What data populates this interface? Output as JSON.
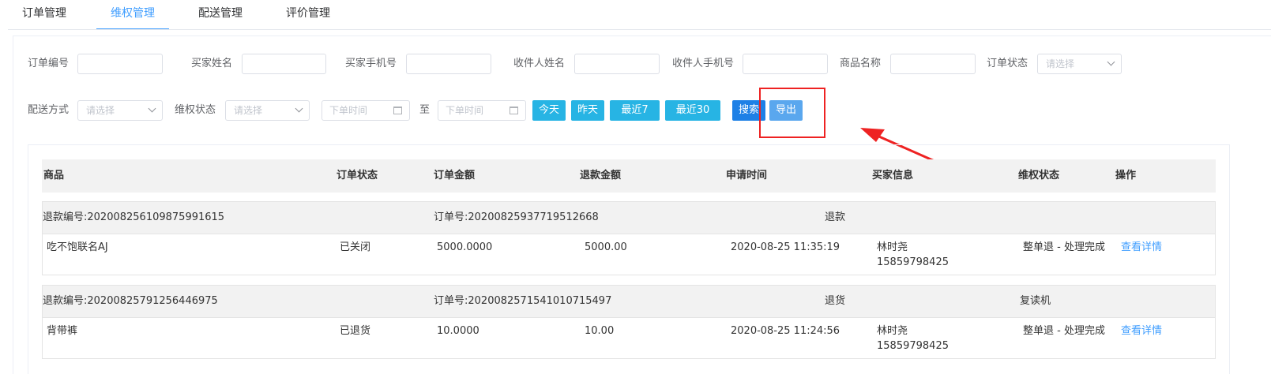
{
  "tabs": [
    {
      "label": "订单管理"
    },
    {
      "label": "维权管理"
    },
    {
      "label": "配送管理"
    },
    {
      "label": "评价管理"
    }
  ],
  "filters": {
    "order_no": "订单编号",
    "buyer_name": "买家姓名",
    "buyer_phone": "买家手机号",
    "receiver_name": "收件人姓名",
    "receiver_phone": "收件人手机号",
    "product_name": "商品名称",
    "order_status": "订单状态",
    "delivery_method": "配送方式",
    "dispute_status": "维权状态",
    "select_placeholder": "请选择",
    "date_placeholder": "下单时间",
    "date_sep": "至"
  },
  "quick_buttons": {
    "today": "今天",
    "yesterday": "昨天",
    "last7": "最近7天",
    "last30": "最近30天"
  },
  "search_label": "搜索",
  "export_label": "导出",
  "table": {
    "headers": [
      "商品",
      "订单状态",
      "订单金额",
      "退款金额",
      "申请时间",
      "买家信息",
      "维权状态",
      "操作"
    ],
    "groups": [
      {
        "refund_no": "退款编号:20200825610987599161​5",
        "order_no": "订单号:20200825937719512668",
        "type": "退款",
        "extra": "",
        "product": "吃不饱联名AJ",
        "status": "已关闭",
        "amount": "5000.0000",
        "refund": "5000.00",
        "time": "2020-08-25 11:35:19",
        "buyer": "林时尧",
        "phone": "15859798425",
        "dispute": "整单退 - 处理完成",
        "action": "查看详情"
      },
      {
        "refund_no": "退款编号:20200825791256446975",
        "order_no": "订单号:202008257154101071​5497",
        "type": "退货",
        "extra": "复读机",
        "product": "背带裤",
        "status": "已退货",
        "amount": "10.0000",
        "refund": "10.00",
        "time": "2020-08-25 11:24:56",
        "buyer": "林时尧",
        "phone": "15859798425",
        "dispute": "整单退 - 处理完成",
        "action": "查看详情"
      }
    ]
  },
  "colors": {
    "accent": "#409eff",
    "quick_button": "#27b4e4",
    "search_button": "#1e80e6",
    "export_button": "#5aa7ee",
    "annotation": "#ee2222"
  }
}
